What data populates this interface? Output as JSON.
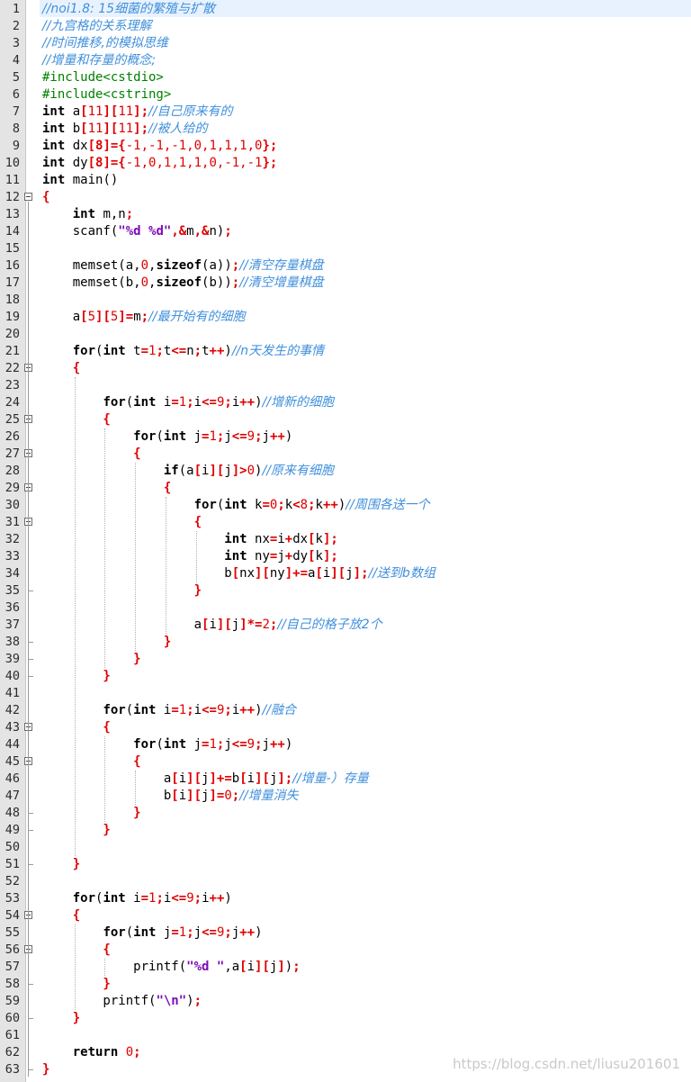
{
  "watermark": "https://blog.csdn.net/liusu201601",
  "highlighted_line": 1,
  "fold_marker_lines": [
    12,
    22,
    25,
    27,
    29,
    31,
    43,
    45,
    54,
    56
  ],
  "lines": [
    [
      [
        "cm",
        "//noi1.8: 15细菌的繁殖与扩散"
      ]
    ],
    [
      [
        "cm",
        "//九宫格的关系理解"
      ]
    ],
    [
      [
        "cm",
        "//时间推移,的模拟思维"
      ]
    ],
    [
      [
        "cm",
        "//增量和存量的概念;"
      ]
    ],
    [
      [
        "pp",
        "#include<cstdio>"
      ]
    ],
    [
      [
        "pp",
        "#include<cstring>"
      ]
    ],
    [
      [
        "kw",
        "int"
      ],
      [
        "t",
        " a"
      ],
      [
        "op",
        "["
      ],
      [
        "num",
        "11"
      ],
      [
        "op",
        "]["
      ],
      [
        "num",
        "11"
      ],
      [
        "op",
        "];"
      ],
      [
        "cm",
        "//自己原来有的"
      ]
    ],
    [
      [
        "kw",
        "int"
      ],
      [
        "t",
        " b"
      ],
      [
        "op",
        "["
      ],
      [
        "num",
        "11"
      ],
      [
        "op",
        "]["
      ],
      [
        "num",
        "11"
      ],
      [
        "op",
        "];"
      ],
      [
        "cm",
        "//被人给的"
      ]
    ],
    [
      [
        "kw",
        "int"
      ],
      [
        "t",
        " dx"
      ],
      [
        "op",
        "[8]={"
      ],
      [
        "num",
        "-1,-1,-1,0,1,1,1,0"
      ],
      [
        "op",
        "};"
      ]
    ],
    [
      [
        "kw",
        "int"
      ],
      [
        "t",
        " dy"
      ],
      [
        "op",
        "[8]={"
      ],
      [
        "num",
        "-1,0,1,1,1,0,-1,-1"
      ],
      [
        "op",
        "};"
      ]
    ],
    [
      [
        "kw",
        "int"
      ],
      [
        "t",
        " main()"
      ]
    ],
    [
      [
        "op",
        "{"
      ]
    ],
    [
      [
        "t",
        "    "
      ],
      [
        "kw",
        "int"
      ],
      [
        "t",
        " m,n"
      ],
      [
        "op",
        ";"
      ]
    ],
    [
      [
        "t",
        "    scanf("
      ],
      [
        "str",
        "\"%d %d\""
      ],
      [
        "op",
        ",&"
      ],
      [
        "t",
        "m"
      ],
      [
        "op",
        ",&"
      ],
      [
        "t",
        "n)"
      ],
      [
        "op",
        ";"
      ]
    ],
    [
      [
        "t",
        ""
      ]
    ],
    [
      [
        "t",
        "    memset(a,"
      ],
      [
        "num",
        "0"
      ],
      [
        "t",
        ","
      ],
      [
        "kw",
        "sizeof"
      ],
      [
        "t",
        "(a))"
      ],
      [
        "op",
        ";"
      ],
      [
        "cm",
        "//清空存量棋盘"
      ]
    ],
    [
      [
        "t",
        "    memset(b,"
      ],
      [
        "num",
        "0"
      ],
      [
        "t",
        ","
      ],
      [
        "kw",
        "sizeof"
      ],
      [
        "t",
        "(b))"
      ],
      [
        "op",
        ";"
      ],
      [
        "cm",
        "//清空增量棋盘"
      ]
    ],
    [
      [
        "t",
        ""
      ]
    ],
    [
      [
        "t",
        "    a"
      ],
      [
        "op",
        "["
      ],
      [
        "num",
        "5"
      ],
      [
        "op",
        "]["
      ],
      [
        "num",
        "5"
      ],
      [
        "op",
        "]="
      ],
      [
        "t",
        "m"
      ],
      [
        "op",
        ";"
      ],
      [
        "cm",
        "//最开始有的细胞"
      ]
    ],
    [
      [
        "t",
        ""
      ]
    ],
    [
      [
        "t",
        "    "
      ],
      [
        "kw",
        "for"
      ],
      [
        "t",
        "("
      ],
      [
        "kw",
        "int"
      ],
      [
        "t",
        " t"
      ],
      [
        "op",
        "="
      ],
      [
        "num",
        "1"
      ],
      [
        "op",
        ";"
      ],
      [
        "t",
        "t"
      ],
      [
        "op",
        "<="
      ],
      [
        "t",
        "n"
      ],
      [
        "op",
        ";"
      ],
      [
        "t",
        "t"
      ],
      [
        "op",
        "++"
      ],
      [
        "t",
        ")"
      ],
      [
        "cm",
        "//n天发生的事情"
      ]
    ],
    [
      [
        "op",
        "    {"
      ]
    ],
    [
      [
        "t",
        ""
      ]
    ],
    [
      [
        "t",
        "        "
      ],
      [
        "kw",
        "for"
      ],
      [
        "t",
        "("
      ],
      [
        "kw",
        "int"
      ],
      [
        "t",
        " i"
      ],
      [
        "op",
        "="
      ],
      [
        "num",
        "1"
      ],
      [
        "op",
        ";"
      ],
      [
        "t",
        "i"
      ],
      [
        "op",
        "<="
      ],
      [
        "num",
        "9"
      ],
      [
        "op",
        ";"
      ],
      [
        "t",
        "i"
      ],
      [
        "op",
        "++"
      ],
      [
        "t",
        ")"
      ],
      [
        "cm",
        "//增新的细胞"
      ]
    ],
    [
      [
        "op",
        "        {"
      ]
    ],
    [
      [
        "t",
        "            "
      ],
      [
        "kw",
        "for"
      ],
      [
        "t",
        "("
      ],
      [
        "kw",
        "int"
      ],
      [
        "t",
        " j"
      ],
      [
        "op",
        "="
      ],
      [
        "num",
        "1"
      ],
      [
        "op",
        ";"
      ],
      [
        "t",
        "j"
      ],
      [
        "op",
        "<="
      ],
      [
        "num",
        "9"
      ],
      [
        "op",
        ";"
      ],
      [
        "t",
        "j"
      ],
      [
        "op",
        "++"
      ],
      [
        "t",
        ")"
      ]
    ],
    [
      [
        "op",
        "            {"
      ]
    ],
    [
      [
        "t",
        "                "
      ],
      [
        "kw",
        "if"
      ],
      [
        "t",
        "(a"
      ],
      [
        "op",
        "["
      ],
      [
        "t",
        "i"
      ],
      [
        "op",
        "]["
      ],
      [
        "t",
        "j"
      ],
      [
        "op",
        "]>"
      ],
      [
        "num",
        "0"
      ],
      [
        "t",
        ")"
      ],
      [
        "cm",
        "//原来有细胞"
      ]
    ],
    [
      [
        "op",
        "                {"
      ]
    ],
    [
      [
        "t",
        "                    "
      ],
      [
        "kw",
        "for"
      ],
      [
        "t",
        "("
      ],
      [
        "kw",
        "int"
      ],
      [
        "t",
        " k"
      ],
      [
        "op",
        "="
      ],
      [
        "num",
        "0"
      ],
      [
        "op",
        ";"
      ],
      [
        "t",
        "k"
      ],
      [
        "op",
        "<"
      ],
      [
        "num",
        "8"
      ],
      [
        "op",
        ";"
      ],
      [
        "t",
        "k"
      ],
      [
        "op",
        "++"
      ],
      [
        "t",
        ")"
      ],
      [
        "cm",
        "//周围各送一个"
      ]
    ],
    [
      [
        "op",
        "                    {"
      ]
    ],
    [
      [
        "t",
        "                        "
      ],
      [
        "kw",
        "int"
      ],
      [
        "t",
        " nx"
      ],
      [
        "op",
        "="
      ],
      [
        "t",
        "i"
      ],
      [
        "op",
        "+"
      ],
      [
        "t",
        "dx"
      ],
      [
        "op",
        "["
      ],
      [
        "t",
        "k"
      ],
      [
        "op",
        "];"
      ]
    ],
    [
      [
        "t",
        "                        "
      ],
      [
        "kw",
        "int"
      ],
      [
        "t",
        " ny"
      ],
      [
        "op",
        "="
      ],
      [
        "t",
        "j"
      ],
      [
        "op",
        "+"
      ],
      [
        "t",
        "dy"
      ],
      [
        "op",
        "["
      ],
      [
        "t",
        "k"
      ],
      [
        "op",
        "];"
      ]
    ],
    [
      [
        "t",
        "                        b"
      ],
      [
        "op",
        "["
      ],
      [
        "t",
        "nx"
      ],
      [
        "op",
        "]["
      ],
      [
        "t",
        "ny"
      ],
      [
        "op",
        "]+="
      ],
      [
        "t",
        "a"
      ],
      [
        "op",
        "["
      ],
      [
        "t",
        "i"
      ],
      [
        "op",
        "]["
      ],
      [
        "t",
        "j"
      ],
      [
        "op",
        "];"
      ],
      [
        "cm",
        "//送到b数组"
      ]
    ],
    [
      [
        "op",
        "                    }"
      ]
    ],
    [
      [
        "t",
        ""
      ]
    ],
    [
      [
        "t",
        "                    a"
      ],
      [
        "op",
        "["
      ],
      [
        "t",
        "i"
      ],
      [
        "op",
        "]["
      ],
      [
        "t",
        "j"
      ],
      [
        "op",
        "]*="
      ],
      [
        "num",
        "2"
      ],
      [
        "op",
        ";"
      ],
      [
        "cm",
        "//自己的格子放2个"
      ]
    ],
    [
      [
        "op",
        "                }"
      ]
    ],
    [
      [
        "op",
        "            }"
      ]
    ],
    [
      [
        "op",
        "        }"
      ]
    ],
    [
      [
        "t",
        ""
      ]
    ],
    [
      [
        "t",
        "        "
      ],
      [
        "kw",
        "for"
      ],
      [
        "t",
        "("
      ],
      [
        "kw",
        "int"
      ],
      [
        "t",
        " i"
      ],
      [
        "op",
        "="
      ],
      [
        "num",
        "1"
      ],
      [
        "op",
        ";"
      ],
      [
        "t",
        "i"
      ],
      [
        "op",
        "<="
      ],
      [
        "num",
        "9"
      ],
      [
        "op",
        ";"
      ],
      [
        "t",
        "i"
      ],
      [
        "op",
        "++"
      ],
      [
        "t",
        ")"
      ],
      [
        "cm",
        "//融合"
      ]
    ],
    [
      [
        "op",
        "        {"
      ]
    ],
    [
      [
        "t",
        "            "
      ],
      [
        "kw",
        "for"
      ],
      [
        "t",
        "("
      ],
      [
        "kw",
        "int"
      ],
      [
        "t",
        " j"
      ],
      [
        "op",
        "="
      ],
      [
        "num",
        "1"
      ],
      [
        "op",
        ";"
      ],
      [
        "t",
        "j"
      ],
      [
        "op",
        "<="
      ],
      [
        "num",
        "9"
      ],
      [
        "op",
        ";"
      ],
      [
        "t",
        "j"
      ],
      [
        "op",
        "++"
      ],
      [
        "t",
        ")"
      ]
    ],
    [
      [
        "op",
        "            {"
      ]
    ],
    [
      [
        "t",
        "                a"
      ],
      [
        "op",
        "["
      ],
      [
        "t",
        "i"
      ],
      [
        "op",
        "]["
      ],
      [
        "t",
        "j"
      ],
      [
        "op",
        "]+="
      ],
      [
        "t",
        "b"
      ],
      [
        "op",
        "["
      ],
      [
        "t",
        "i"
      ],
      [
        "op",
        "]["
      ],
      [
        "t",
        "j"
      ],
      [
        "op",
        "];"
      ],
      [
        "cm",
        "//增量-）存量"
      ]
    ],
    [
      [
        "t",
        "                b"
      ],
      [
        "op",
        "["
      ],
      [
        "t",
        "i"
      ],
      [
        "op",
        "]["
      ],
      [
        "t",
        "j"
      ],
      [
        "op",
        "]="
      ],
      [
        "num",
        "0"
      ],
      [
        "op",
        ";"
      ],
      [
        "cm",
        "//增量消失"
      ]
    ],
    [
      [
        "op",
        "            }"
      ]
    ],
    [
      [
        "op",
        "        }"
      ]
    ],
    [
      [
        "t",
        ""
      ]
    ],
    [
      [
        "op",
        "    }"
      ]
    ],
    [
      [
        "t",
        ""
      ]
    ],
    [
      [
        "t",
        "    "
      ],
      [
        "kw",
        "for"
      ],
      [
        "t",
        "("
      ],
      [
        "kw",
        "int"
      ],
      [
        "t",
        " i"
      ],
      [
        "op",
        "="
      ],
      [
        "num",
        "1"
      ],
      [
        "op",
        ";"
      ],
      [
        "t",
        "i"
      ],
      [
        "op",
        "<="
      ],
      [
        "num",
        "9"
      ],
      [
        "op",
        ";"
      ],
      [
        "t",
        "i"
      ],
      [
        "op",
        "++"
      ],
      [
        "t",
        ")"
      ]
    ],
    [
      [
        "op",
        "    {"
      ]
    ],
    [
      [
        "t",
        "        "
      ],
      [
        "kw",
        "for"
      ],
      [
        "t",
        "("
      ],
      [
        "kw",
        "int"
      ],
      [
        "t",
        " j"
      ],
      [
        "op",
        "="
      ],
      [
        "num",
        "1"
      ],
      [
        "op",
        ";"
      ],
      [
        "t",
        "j"
      ],
      [
        "op",
        "<="
      ],
      [
        "num",
        "9"
      ],
      [
        "op",
        ";"
      ],
      [
        "t",
        "j"
      ],
      [
        "op",
        "++"
      ],
      [
        "t",
        ")"
      ]
    ],
    [
      [
        "op",
        "        {"
      ]
    ],
    [
      [
        "t",
        "            printf("
      ],
      [
        "str",
        "\"%d \""
      ],
      [
        "t",
        ",a"
      ],
      [
        "op",
        "["
      ],
      [
        "t",
        "i"
      ],
      [
        "op",
        "]["
      ],
      [
        "t",
        "j"
      ],
      [
        "op",
        "]"
      ],
      [
        "t",
        ")"
      ],
      [
        "op",
        ";"
      ]
    ],
    [
      [
        "op",
        "        }"
      ]
    ],
    [
      [
        "t",
        "        printf("
      ],
      [
        "str",
        "\"\\n\""
      ],
      [
        "t",
        ")"
      ],
      [
        "op",
        ";"
      ]
    ],
    [
      [
        "op",
        "    }"
      ]
    ],
    [
      [
        "t",
        ""
      ]
    ],
    [
      [
        "t",
        "    "
      ],
      [
        "kw",
        "return"
      ],
      [
        "t",
        " "
      ],
      [
        "num",
        "0"
      ],
      [
        "op",
        ";"
      ]
    ],
    [
      [
        "op",
        "}"
      ]
    ]
  ]
}
